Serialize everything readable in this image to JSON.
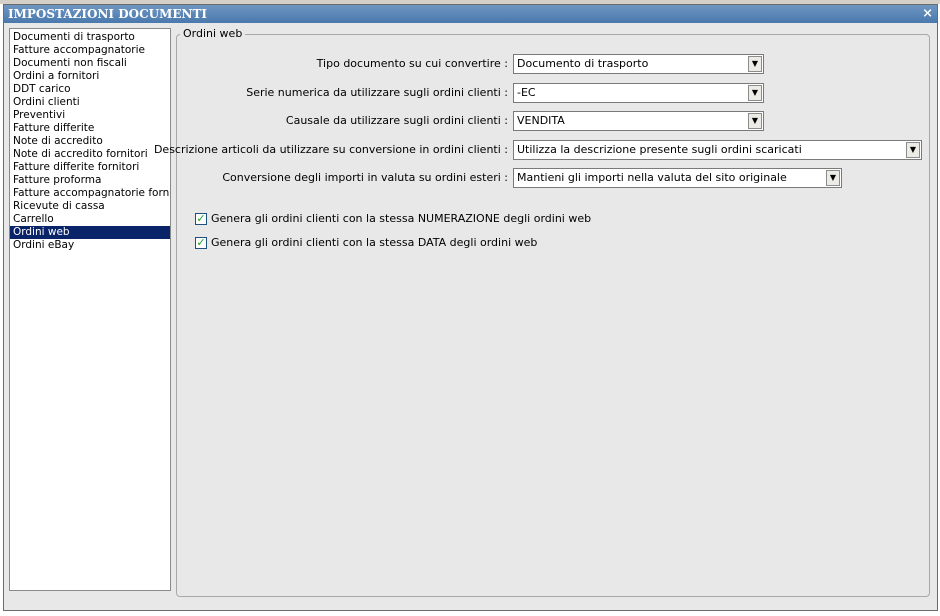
{
  "window": {
    "title": "IMPOSTAZIONI DOCUMENTI",
    "close_label": "×"
  },
  "sidebar": {
    "items": [
      {
        "label": "Documenti di trasporto"
      },
      {
        "label": "Fatture accompagnatorie"
      },
      {
        "label": "Documenti non fiscali"
      },
      {
        "label": "Ordini a fornitori"
      },
      {
        "label": "DDT carico"
      },
      {
        "label": "Ordini clienti"
      },
      {
        "label": "Preventivi"
      },
      {
        "label": "Fatture differite"
      },
      {
        "label": "Note di accredito"
      },
      {
        "label": "Note di accredito fornitori"
      },
      {
        "label": "Fatture differite fornitori"
      },
      {
        "label": "Fatture proforma"
      },
      {
        "label": "Fatture accompagnatorie fornito"
      },
      {
        "label": "Ricevute di cassa"
      },
      {
        "label": "Carrello"
      },
      {
        "label": "Ordini web"
      },
      {
        "label": "Ordini eBay"
      }
    ],
    "selected_index": 15
  },
  "panel": {
    "legend": "Ordini web",
    "fields": [
      {
        "label": "Tipo documento su cui convertire :",
        "value": "Documento di trasporto"
      },
      {
        "label": "Serie numerica da utilizzare sugli ordini clienti :",
        "value": "-EC"
      },
      {
        "label": "Causale da utilizzare sugli ordini clienti :",
        "value": "VENDITA"
      },
      {
        "label": "Descrizione articoli da utilizzare su conversione in ordini clienti :",
        "value": "Utilizza la descrizione presente sugli ordini scaricati"
      },
      {
        "label": "Conversione degli importi in valuta su ordini esteri :",
        "value": "Mantieni gli importi nella valuta del sito originale"
      }
    ],
    "checkboxes": [
      {
        "label": "Genera gli ordini clienti con la stessa NUMERAZIONE degli ordini web",
        "checked": true,
        "mark": "✓"
      },
      {
        "label": "Genera gli ordini clienti con la stessa DATA degli ordini web",
        "checked": true,
        "mark": "✓"
      }
    ]
  },
  "icons": {
    "dropdown_arrow": "▼"
  }
}
